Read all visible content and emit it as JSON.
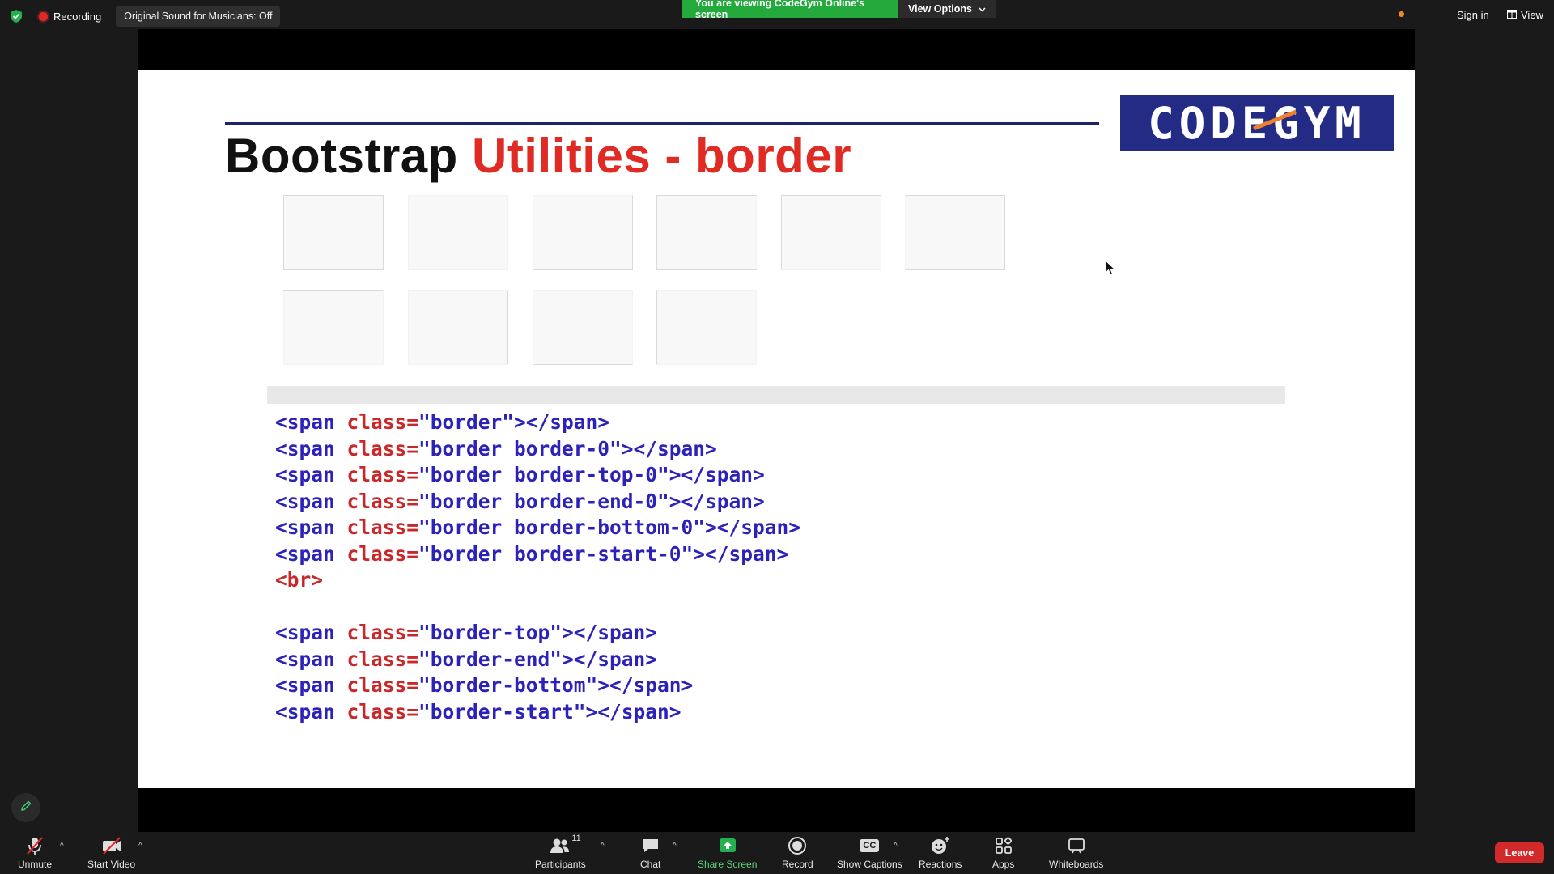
{
  "top_bar": {
    "recording_label": "Recording",
    "original_sound": "Original Sound for Musicians: Off",
    "viewing_banner": "You are viewing CodeGym Online's screen",
    "view_options": "View Options",
    "sign_in": "Sign in",
    "view": "View"
  },
  "slide": {
    "title_black": "Bootstrap ",
    "title_red": "Utilities - border",
    "logo_text": "CODEGYM",
    "code_lines_1": [
      {
        "open": "<span ",
        "attr": "class=",
        "val": "\"border\"",
        "close": "></span>"
      },
      {
        "open": "<span ",
        "attr": "class=",
        "val": "\"border border-0\"",
        "close": "></span>"
      },
      {
        "open": "<span ",
        "attr": "class=",
        "val": "\"border border-top-0\"",
        "close": "></span>"
      },
      {
        "open": "<span ",
        "attr": "class=",
        "val": "\"border border-end-0\"",
        "close": "></span>"
      },
      {
        "open": "<span ",
        "attr": "class=",
        "val": "\"border border-bottom-0\"",
        "close": "></span>"
      },
      {
        "open": "<span ",
        "attr": "class=",
        "val": "\"border border-start-0\"",
        "close": "></span>"
      }
    ],
    "br_line": "<br>",
    "code_lines_2": [
      {
        "open": "<span ",
        "attr": "class=",
        "val": "\"border-top\"",
        "close": "></span>"
      },
      {
        "open": "<span ",
        "attr": "class=",
        "val": "\"border-end\"",
        "close": "></span>"
      },
      {
        "open": "<span ",
        "attr": "class=",
        "val": "\"border-bottom\"",
        "close": "></span>"
      },
      {
        "open": "<span ",
        "attr": "class=",
        "val": "\"border-start\"",
        "close": "></span>"
      }
    ]
  },
  "toolbar": {
    "unmute": "Unmute",
    "start_video": "Start Video",
    "participants": "Participants",
    "participant_count": "11",
    "chat": "Chat",
    "share_screen": "Share Screen",
    "record": "Record",
    "show_captions": "Show Captions",
    "captions_icon_text": "CC",
    "reactions": "Reactions",
    "apps": "Apps",
    "whiteboards": "Whiteboards",
    "leave": "Leave"
  },
  "colors": {
    "banner_green": "#23a93c",
    "leave_red": "#d22a2a",
    "title_red": "#e02b25",
    "logo_blue": "#232b85"
  }
}
